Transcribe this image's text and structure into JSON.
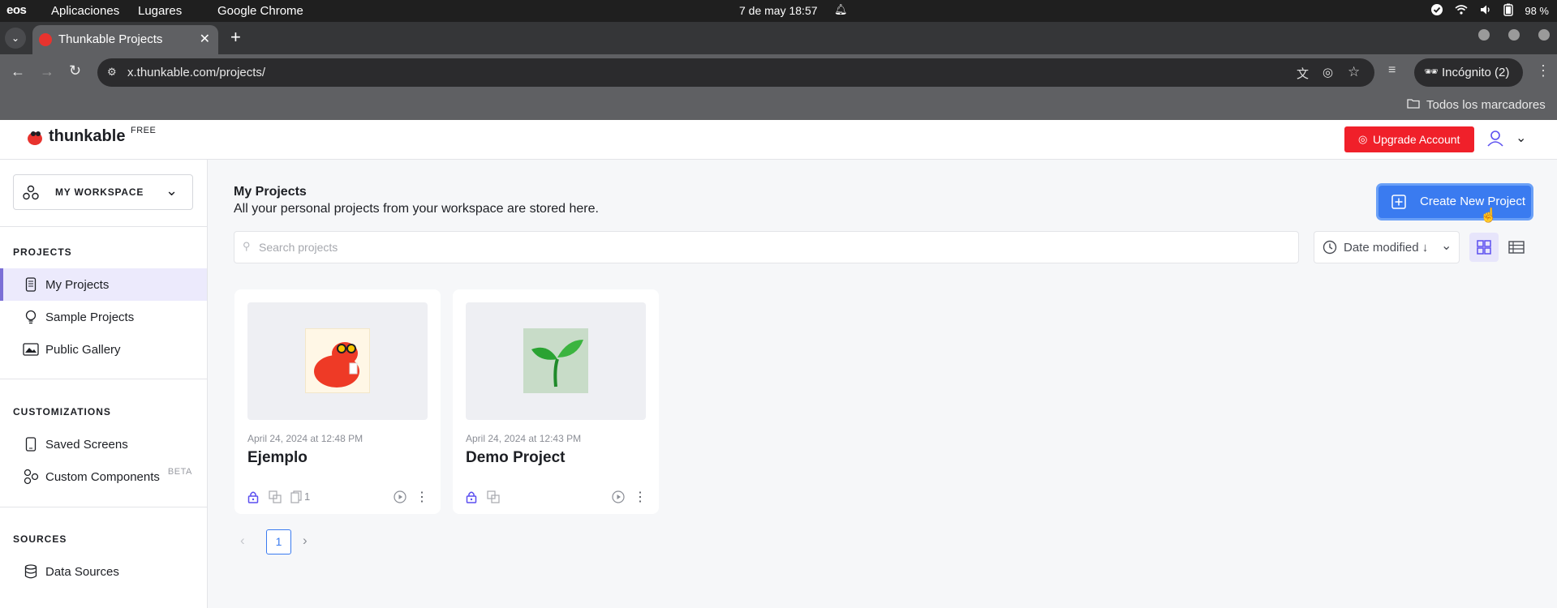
{
  "os": {
    "logo": "eos",
    "menu": [
      "Aplicaciones",
      "Lugares",
      "Google Chrome"
    ],
    "clock": "7 de may  18:57",
    "battery": "98 %"
  },
  "browser": {
    "tab_title": "Thunkable Projects",
    "url": "x.thunkable.com/projects/",
    "incognito_label": "Incógnito (2)",
    "bookmarks_label": "Todos los marcadores"
  },
  "app": {
    "brand": "thunkable",
    "plan_badge": "FREE",
    "upgrade_label": "Upgrade Account",
    "accent": "#5b4ff0",
    "upgrade_color": "#f0202a",
    "primary_blue": "#3a7bf0"
  },
  "sidebar": {
    "workspace_label": "MY WORKSPACE",
    "sections": [
      {
        "title": "PROJECTS",
        "items": [
          {
            "label": "My Projects",
            "icon": "phone-icon"
          },
          {
            "label": "Sample Projects",
            "icon": "lightbulb-icon"
          },
          {
            "label": "Public Gallery",
            "icon": "gallery-icon"
          }
        ]
      },
      {
        "title": "CUSTOMIZATIONS",
        "items": [
          {
            "label": "Saved Screens",
            "icon": "phone-icon"
          },
          {
            "label": "Custom Components",
            "icon": "components-icon",
            "badge": "BETA"
          }
        ]
      },
      {
        "title": "SOURCES",
        "items": [
          {
            "label": "Data Sources",
            "icon": "database-icon"
          }
        ]
      }
    ]
  },
  "main": {
    "title": "My Projects",
    "subtitle": "All your personal projects from your workspace are stored here.",
    "create_label": "Create New Project",
    "search_placeholder": "Search projects",
    "sort_label": "Date modified ↓",
    "projects": [
      {
        "date": "April 24, 2024 at 12:48 PM",
        "title": "Ejemplo",
        "copies": "1",
        "thumb": "mascot-image"
      },
      {
        "date": "April 24, 2024 at 12:43 PM",
        "title": "Demo Project",
        "thumb": "sprout-image"
      }
    ],
    "pagination": {
      "current": "1",
      "prev": "‹",
      "next": "›"
    }
  }
}
